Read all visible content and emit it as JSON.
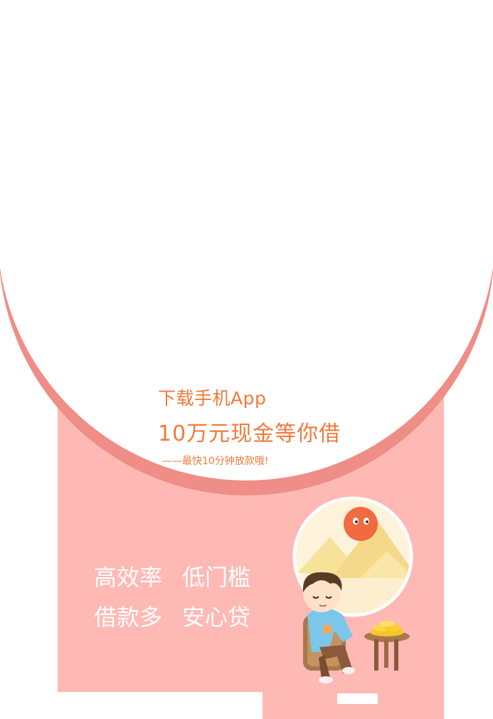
{
  "promo": {
    "line1": "下载手机App",
    "line2": "10万元现金等你借",
    "line3": "——最快10分钟放款哦!"
  },
  "features": {
    "item1": "高效率",
    "item2": "低门槛",
    "item3": "借款多",
    "item4": "安心贷"
  },
  "colors": {
    "panel": "#ffb9b4",
    "arc_border": "#ef8d87",
    "headline": "#f07a3a",
    "feature_text": "#ffffff"
  },
  "icons": {
    "illustration": "man-with-coins-illustration"
  }
}
